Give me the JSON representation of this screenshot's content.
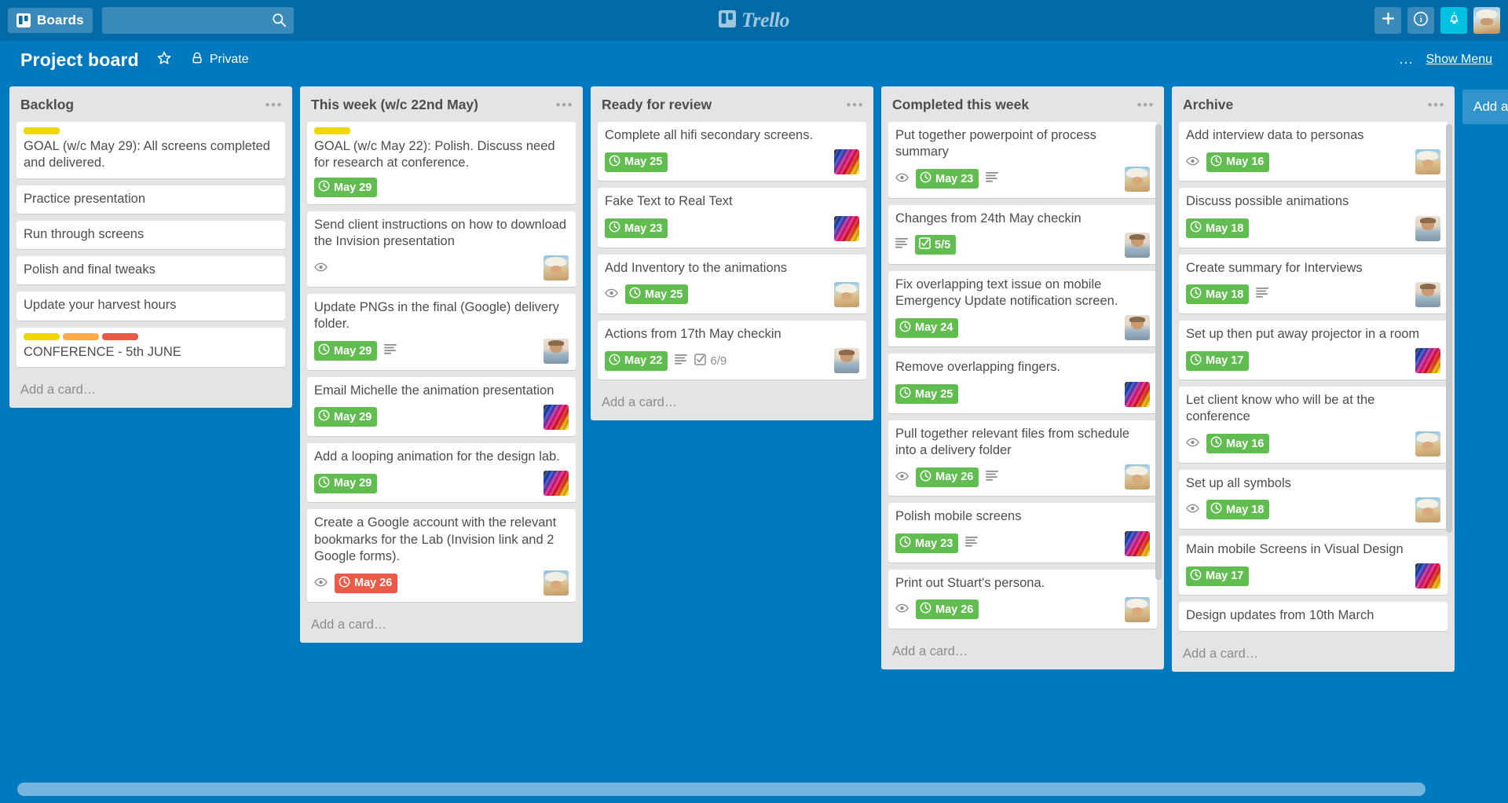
{
  "header": {
    "boards_label": "Boards",
    "boards_icon": "boards-icon",
    "search_placeholder": "",
    "search_value": "",
    "search_icon": "search-icon",
    "logo_text": "Trello",
    "add_icon": "plus-icon",
    "info_icon": "info-icon",
    "notifications_icon": "bell-icon",
    "avatar": "user-avatar"
  },
  "board": {
    "title": "Project board",
    "star_icon": "star-icon",
    "visibility_icon": "lock-icon",
    "visibility": "Private",
    "menu_dots": "…",
    "show_menu": "Show Menu",
    "add_list_label": "Add a list…"
  },
  "colors": {
    "brand_blue": "#0079BF",
    "header_blue": "#026AA7",
    "list_grey": "#E2E4E6",
    "due_green": "#61BD4F",
    "due_red": "#EB5A46",
    "label_yellow": "#F2D600",
    "label_orange": "#FFAB4A",
    "label_red": "#EB5A46",
    "notification_cyan": "#00C2E0"
  },
  "lists": [
    {
      "title": "Backlog",
      "add_card": "Add a card…",
      "has_scrollbar": false,
      "cards": [
        {
          "title": "GOAL (w/c May 29): All screens completed and delivered.",
          "labels": [
            "#F2D600"
          ],
          "badges": [],
          "members": []
        },
        {
          "title": "Practice presentation",
          "labels": [],
          "badges": [],
          "members": []
        },
        {
          "title": "Run through screens",
          "labels": [],
          "badges": [],
          "members": []
        },
        {
          "title": "Polish and final tweaks",
          "labels": [],
          "badges": [],
          "members": []
        },
        {
          "title": "Update your harvest hours",
          "labels": [],
          "badges": [],
          "members": []
        },
        {
          "title": "CONFERENCE - 5th JUNE",
          "labels": [
            "#F2D600",
            "#FFAB4A",
            "#EB5A46"
          ],
          "badges": [],
          "members": []
        }
      ]
    },
    {
      "title": "This week (w/c 22nd May)",
      "add_card": "Add a card…",
      "has_scrollbar": false,
      "cards": [
        {
          "title": "GOAL (w/c May 22): Polish. Discuss need for research at conference.",
          "labels": [
            "#F2D600"
          ],
          "badges": [
            {
              "type": "due",
              "state": "none",
              "text": "May 29"
            }
          ],
          "members": []
        },
        {
          "title": "Send client instructions on how to download the Invision presentation",
          "labels": [],
          "badges": [
            {
              "type": "watch",
              "text": ""
            }
          ],
          "members": [
            "beach"
          ]
        },
        {
          "title": "Update PNGs in the final (Google) delivery folder.",
          "labels": [],
          "badges": [
            {
              "type": "due",
              "state": "none",
              "text": "May 29"
            },
            {
              "type": "description",
              "text": ""
            }
          ],
          "members": [
            "man"
          ]
        },
        {
          "title": "Email Michelle the animation presentation",
          "labels": [],
          "badges": [
            {
              "type": "due",
              "state": "none",
              "text": "May 29"
            }
          ],
          "members": [
            "lego"
          ]
        },
        {
          "title": "Add a looping animation for the design lab.",
          "labels": [],
          "badges": [
            {
              "type": "due",
              "state": "none",
              "text": "May 29"
            }
          ],
          "members": [
            "lego"
          ]
        },
        {
          "title": "Create a Google account with the relevant bookmarks for the Lab (Invision link and 2 Google forms).",
          "labels": [],
          "badges": [
            {
              "type": "watch",
              "text": ""
            },
            {
              "type": "due",
              "state": "overdue",
              "text": "May 26"
            }
          ],
          "members": [
            "beach"
          ]
        }
      ]
    },
    {
      "title": "Ready for review",
      "add_card": "Add a card…",
      "has_scrollbar": false,
      "cards": [
        {
          "title": "Complete all hifi secondary screens.",
          "labels": [],
          "badges": [
            {
              "type": "due",
              "state": "complete",
              "text": "May 25"
            }
          ],
          "members": [
            "lego"
          ]
        },
        {
          "title": "Fake Text to Real Text",
          "labels": [],
          "badges": [
            {
              "type": "due",
              "state": "complete",
              "text": "May 23"
            }
          ],
          "members": [
            "lego"
          ]
        },
        {
          "title": "Add Inventory to the animations",
          "labels": [],
          "badges": [
            {
              "type": "watch",
              "text": ""
            },
            {
              "type": "due",
              "state": "complete",
              "text": "May 25"
            }
          ],
          "members": [
            "beach"
          ]
        },
        {
          "title": "Actions from 17th May checkin",
          "labels": [],
          "badges": [
            {
              "type": "due",
              "state": "complete",
              "text": "May 22"
            },
            {
              "type": "description",
              "text": ""
            },
            {
              "type": "checklist",
              "state": "partial",
              "text": "6/9"
            }
          ],
          "members": [
            "man"
          ]
        }
      ]
    },
    {
      "title": "Completed this week",
      "add_card": "Add a card…",
      "has_scrollbar": true,
      "cards": [
        {
          "title": "Put together powerpoint of process summary",
          "labels": [],
          "badges": [
            {
              "type": "watch",
              "text": ""
            },
            {
              "type": "due",
              "state": "complete",
              "text": "May 23"
            },
            {
              "type": "description",
              "text": ""
            }
          ],
          "members": [
            "beach"
          ]
        },
        {
          "title": "Changes from 24th May checkin",
          "labels": [],
          "badges": [
            {
              "type": "description",
              "text": ""
            },
            {
              "type": "checklist",
              "state": "complete",
              "text": "5/5"
            }
          ],
          "members": [
            "man"
          ]
        },
        {
          "title": "Fix overlapping text issue on mobile Emergency Update notification screen.",
          "labels": [],
          "badges": [
            {
              "type": "due",
              "state": "complete",
              "text": "May 24"
            }
          ],
          "members": [
            "man"
          ]
        },
        {
          "title": "Remove overlapping fingers.",
          "labels": [],
          "badges": [
            {
              "type": "due",
              "state": "complete",
              "text": "May 25"
            }
          ],
          "members": [
            "lego"
          ]
        },
        {
          "title": "Pull together relevant files from schedule into a delivery folder",
          "labels": [],
          "badges": [
            {
              "type": "watch",
              "text": ""
            },
            {
              "type": "due",
              "state": "complete",
              "text": "May 26"
            },
            {
              "type": "description",
              "text": ""
            }
          ],
          "members": [
            "beach"
          ]
        },
        {
          "title": "Polish mobile screens",
          "labels": [],
          "badges": [
            {
              "type": "due",
              "state": "complete",
              "text": "May 23"
            },
            {
              "type": "description",
              "text": ""
            }
          ],
          "members": [
            "lego"
          ]
        },
        {
          "title": "Print out Stuart's persona.",
          "labels": [],
          "badges": [
            {
              "type": "watch",
              "text": ""
            },
            {
              "type": "due",
              "state": "complete",
              "text": "May 26"
            }
          ],
          "members": [
            "beach"
          ]
        }
      ]
    },
    {
      "title": "Archive",
      "add_card": "Add a card…",
      "has_scrollbar": true,
      "cards": [
        {
          "title": "Add interview data to personas",
          "labels": [],
          "badges": [
            {
              "type": "watch",
              "text": ""
            },
            {
              "type": "due",
              "state": "complete",
              "text": "May 16"
            }
          ],
          "members": [
            "beach"
          ]
        },
        {
          "title": "Discuss possible animations",
          "labels": [],
          "badges": [
            {
              "type": "due",
              "state": "complete",
              "text": "May 18"
            }
          ],
          "members": [
            "man"
          ]
        },
        {
          "title": "Create summary for Interviews",
          "labels": [],
          "badges": [
            {
              "type": "due",
              "state": "complete",
              "text": "May 18"
            },
            {
              "type": "description",
              "text": ""
            }
          ],
          "members": [
            "man"
          ]
        },
        {
          "title": "Set up then put away projector in a room",
          "labels": [],
          "badges": [
            {
              "type": "due",
              "state": "complete",
              "text": "May 17"
            }
          ],
          "members": [
            "lego"
          ]
        },
        {
          "title": "Let client know who will be at the conference",
          "labels": [],
          "badges": [
            {
              "type": "watch",
              "text": ""
            },
            {
              "type": "due",
              "state": "complete",
              "text": "May 16"
            }
          ],
          "members": [
            "beach"
          ]
        },
        {
          "title": "Set up all symbols",
          "labels": [],
          "badges": [
            {
              "type": "watch",
              "text": ""
            },
            {
              "type": "due",
              "state": "complete",
              "text": "May 18"
            }
          ],
          "members": [
            "beach"
          ]
        },
        {
          "title": "Main mobile Screens in Visual Design",
          "labels": [],
          "badges": [
            {
              "type": "due",
              "state": "complete",
              "text": "May 17"
            }
          ],
          "members": [
            "lego"
          ]
        },
        {
          "title": "Design updates from 10th March",
          "labels": [],
          "badges": [],
          "members": []
        }
      ]
    }
  ]
}
